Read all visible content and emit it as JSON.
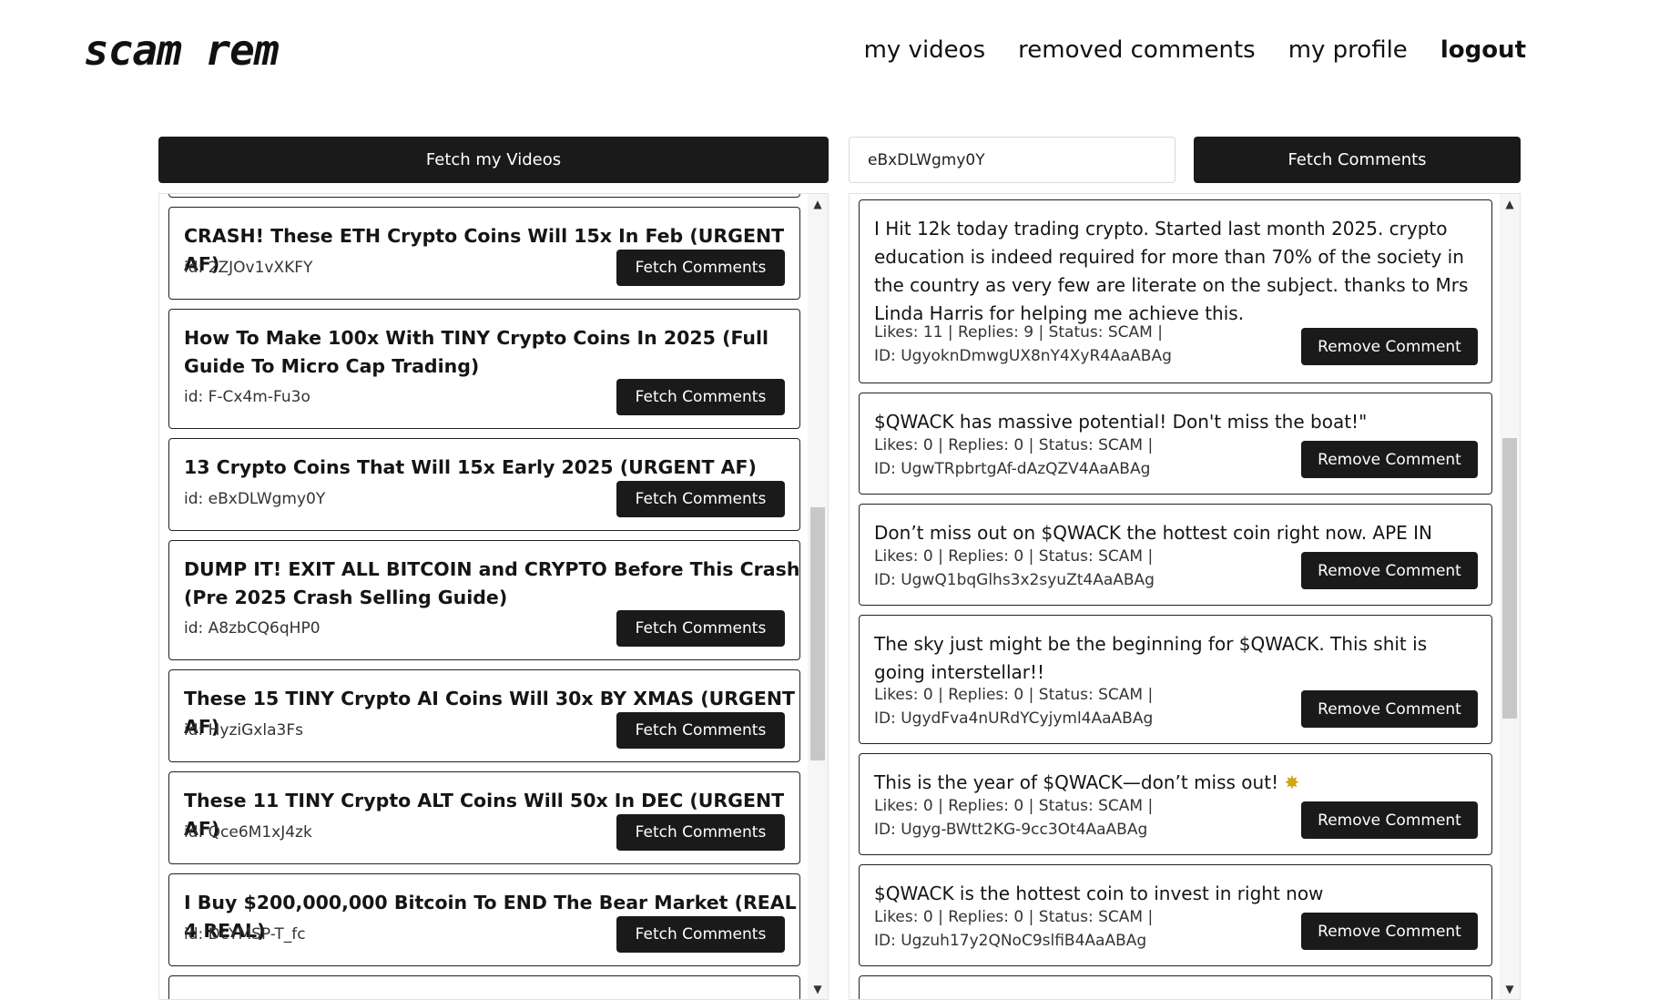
{
  "header": {
    "logo": "scam rem",
    "nav": {
      "my_videos": "my videos",
      "removed_comments": "removed comments",
      "my_profile": "my profile",
      "logout": "logout"
    }
  },
  "controls": {
    "fetch_videos_label": "Fetch my Videos",
    "video_id_value": "eBxDLWgmy0Y",
    "fetch_comments_label": "Fetch Comments"
  },
  "videos": [
    {
      "title": "CRASH! These ETH Crypto Coins Will 15x In Feb (URGENT AF)",
      "id": "id: 2ZJOv1vXKFY",
      "button": "Fetch Comments"
    },
    {
      "title": "How To Make 100x With TINY Crypto Coins In 2025 (Full Guide To Micro Cap Trading)",
      "id": "id: F-Cx4m-Fu3o",
      "button": "Fetch Comments"
    },
    {
      "title": "13 Crypto Coins That Will 15x Early 2025 (URGENT AF)",
      "id": "id: eBxDLWgmy0Y",
      "button": "Fetch Comments"
    },
    {
      "title": "DUMP IT! EXIT ALL BITCOIN and CRYPTO Before This Crash (Pre 2025 Crash Selling Guide)",
      "id": "id: A8zbCQ6qHP0",
      "button": "Fetch Comments"
    },
    {
      "title": "These 15 TINY Crypto AI Coins Will 30x BY XMAS (URGENT AF)",
      "id": "id: HyziGxla3Fs",
      "button": "Fetch Comments"
    },
    {
      "title": "These 11 TINY Crypto ALT Coins Will 50x In DEC (URGENT AF)",
      "id": "id: Qce6M1xJ4zk",
      "button": "Fetch Comments"
    },
    {
      "title": "I Buy $200,000,000 Bitcoin To END The Bear Market (REAL 4 REAL)",
      "id": "id: DcYMSP-T_fc",
      "button": "Fetch Comments"
    }
  ],
  "comments": [
    {
      "text": "I Hit 12k today trading crypto. Started last month 2025. crypto education is indeed required for more than 70% of the society in the country as very few are literate on the subject. thanks to Mrs Linda Harris for helping me achieve this.",
      "stats": "Likes: 11 | Replies: 9 | Status: SCAM |",
      "id": "ID: UgyoknDmwgUX8nY4XyR4AaABAg",
      "button": "Remove Comment"
    },
    {
      "text": "$QWACK has massive potential! Don't miss the boat!\"",
      "stats": "Likes: 0 | Replies: 0 | Status: SCAM |",
      "id": "ID: UgwTRpbrtgAf-dAzQZV4AaABAg",
      "button": "Remove Comment"
    },
    {
      "text": "Don’t miss out on $QWACK the hottest coin right now. APE IN",
      "stats": "Likes: 0 | Replies: 0 | Status: SCAM |",
      "id": "ID: UgwQ1bqGlhs3x2syuZt4AaABAg",
      "button": "Remove Comment"
    },
    {
      "text": "The sky just might be the beginning for $QWACK. This shit is going interstellar!!",
      "stats": "Likes: 0 | Replies: 0 | Status: SCAM |",
      "id": "ID: UgydFva4nURdYCyjyml4AaABAg",
      "button": "Remove Comment"
    },
    {
      "text": "This is the year of $QWACK—don’t miss out! ",
      "emoji": "✸",
      "stats": "Likes: 0 | Replies: 0 | Status: SCAM |",
      "id": "ID: Ugyg-BWtt2KG-9cc3Ot4AaABAg",
      "button": "Remove Comment"
    },
    {
      "text": "$QWACK is the hottest coin to invest in right now",
      "stats": "Likes: 0 | Replies: 0 | Status: SCAM |",
      "id": "ID: Ugzuh17y2QNoC9slfiB4AaABAg",
      "button": "Remove Comment"
    }
  ]
}
